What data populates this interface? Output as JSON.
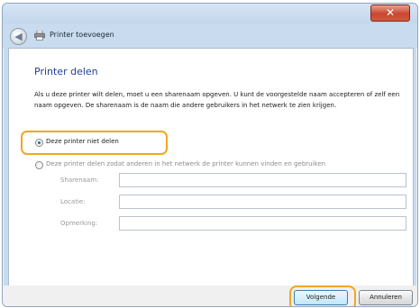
{
  "window": {
    "title": "Printer toevoegen",
    "close_symbol": "✕"
  },
  "header": {
    "back_symbol": "◀"
  },
  "content": {
    "heading": "Printer delen",
    "description": "Als u deze printer wilt delen, moet u een sharenaam opgeven. U kunt de voorgestelde naam accepteren of zelf een naam opgeven. De sharenaam is de naam die andere gebruikers in het netwerk te zien krijgen.",
    "options": [
      {
        "label": "Deze printer niet delen",
        "selected": true
      },
      {
        "label": "Deze printer delen zodat anderen in het netwerk de printer kunnen vinden en gebruiken",
        "selected": false
      }
    ],
    "fields": [
      {
        "label": "Sharenaam:",
        "value": ""
      },
      {
        "label": "Locatie:",
        "value": ""
      },
      {
        "label": "Opmerking:",
        "value": ""
      }
    ]
  },
  "buttons": {
    "next": "Volgende",
    "cancel": "Annuleren"
  },
  "colors": {
    "highlight": "#f2a623",
    "heading": "#1f3f9b",
    "close": "#c9462f"
  },
  "icons": [
    "back-arrow-icon",
    "printer-icon",
    "close-icon"
  ]
}
